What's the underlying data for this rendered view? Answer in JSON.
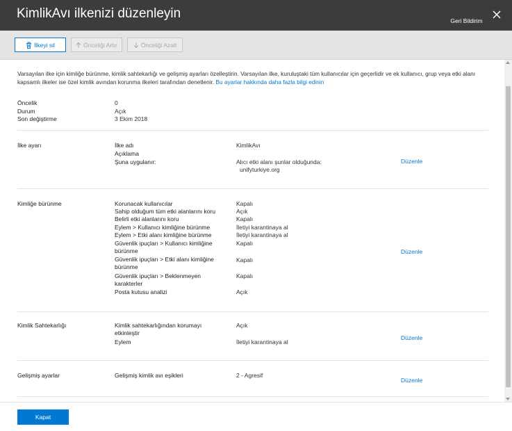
{
  "dialog": {
    "title": "KimlikAvı ilkenizi düzenleyin"
  },
  "toolbar": {
    "delete_label": "İlkeyi sil",
    "increase_label": "Önceliği Artır",
    "decrease_label": "Önceliği Azalt"
  },
  "intro": {
    "text": "Varsayılan ilke için kimliğe bürünme, kimlik sahtekarlığı ve gelişmiş ayarları özelleştirin. Varsayılan ilke, kuruluştaki tüm kullanıcılar için geçerlidir ve ek kullanıcı, grup veya etki alanı kapsamlı ilkeler ise özel kimlik avından korunma ilkeleri tarafından denetlenir. ",
    "link": "Bu ayarlar hakkında daha fazla bilgi edinin"
  },
  "summary": [
    {
      "label": "Öncelik",
      "value": "0"
    },
    {
      "label": "Durum",
      "value": "Açık"
    },
    {
      "label": "Son değiştirme",
      "value": "3 Ekim 2018"
    }
  ],
  "edit_label": "Düzenle",
  "policy": {
    "title": "İlke ayarı",
    "name_label": "İlke adı",
    "name_value": "KimlikAvı",
    "desc_label": "Açıklama",
    "apply_label": "Şuna uygulanır:",
    "apply_value1": "Alıcı etki alanı şunlar olduğunda:",
    "apply_value2": "unifyturkiye.org"
  },
  "impersonation": {
    "title": "Kimliğe bürünme",
    "rows": [
      {
        "label": "Korunacak kullanıcılar",
        "value": "Kapalı"
      },
      {
        "label": "Sahip olduğum tüm etki alanlarını koru",
        "value": "Açık"
      },
      {
        "label": "Belirli etki alanlarını koru",
        "value": "Kapalı"
      },
      {
        "label": "Eylem > Kullanıcı kimliğine bürünme",
        "value": "İletiyi karantinaya al"
      },
      {
        "label": "Eylem > Etki alanı kimliğine bürünme",
        "value": "İletiyi karantinaya al"
      },
      {
        "label": "Güvenlik ipuçları > Kullanıcı kimliğine bürünme",
        "value": "Kapalı"
      },
      {
        "label": "Güvenlik ipuçları > Etki alanı kimliğine bürünme",
        "value": "Kapalı"
      },
      {
        "label": "Güvenlik ipuçları > Beklenmeyen karakterler",
        "value": "Kapalı"
      },
      {
        "label": "Posta kutusu analizi",
        "value": "Açık"
      }
    ]
  },
  "spoof": {
    "title": "Kimlik Sahtekarlığı",
    "rows": [
      {
        "label": "Kimlik sahtekarlığından korumayı etkinleştir",
        "value": "Açık"
      },
      {
        "label": "Eylem",
        "value": "İletiyi karantinaya al"
      }
    ]
  },
  "advanced": {
    "title": "Gelişmiş ayarlar",
    "rows": [
      {
        "label": "Gelişmiş kimlik avı eşikleri",
        "value": "2 - Agresif"
      }
    ]
  },
  "footer": {
    "close_label": "Kapat",
    "feedback_label": "Geri Bildirim"
  }
}
